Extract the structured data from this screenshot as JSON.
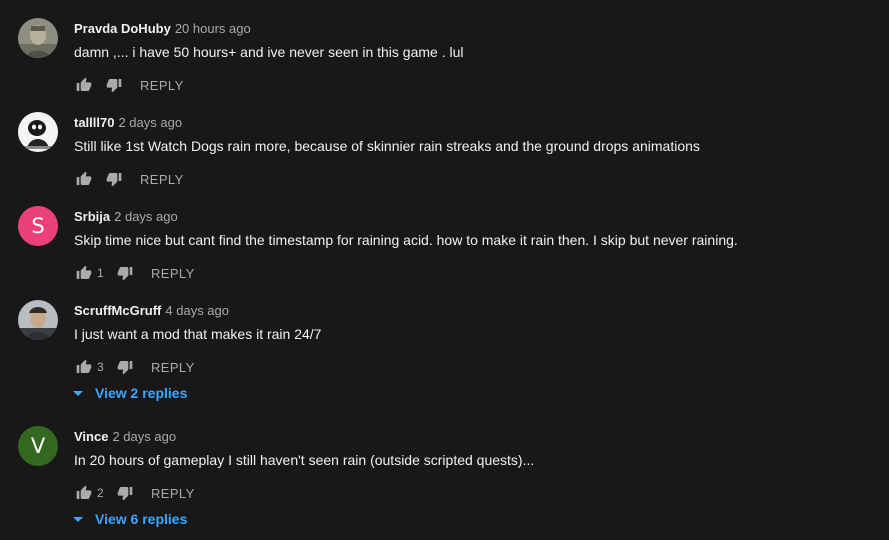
{
  "labels": {
    "reply": "REPLY"
  },
  "comments": [
    {
      "author": "Pravda DoHuby",
      "time": "20 hours ago",
      "text": "damn ,... i have 50 hours+ and ive never seen in this game . lul",
      "likes": "",
      "avatar": {
        "type": "photo",
        "color": "#8a8c7a"
      }
    },
    {
      "author": "tallll70",
      "time": "2 days ago",
      "text": "Still like 1st Watch Dogs rain more, because of skinnier rain streaks and the ground drops animations",
      "likes": "",
      "avatar": {
        "type": "photo",
        "color": "#f2f2f2"
      }
    },
    {
      "author": "Srbija",
      "time": "2 days ago",
      "text": "Skip time nice but cant find the timestamp for raining acid. how to make it rain then. I skip but never raining.",
      "likes": "1",
      "avatar": {
        "type": "letter",
        "letter": "S",
        "color": "#ec407a"
      }
    },
    {
      "author": "ScruffMcGruff",
      "time": "4 days ago",
      "text": "I just want a mod that makes it rain 24/7",
      "likes": "3",
      "replies_label": "View 2 replies",
      "avatar": {
        "type": "photo",
        "color": "#5a5f66"
      }
    },
    {
      "author": "Vince",
      "time": "2 days ago",
      "text": "In 20 hours of gameplay I still haven't seen rain (outside scripted quests)...",
      "likes": "2",
      "replies_label": "View 6 replies",
      "avatar": {
        "type": "letter",
        "letter": "V",
        "color": "#33691e"
      }
    }
  ]
}
